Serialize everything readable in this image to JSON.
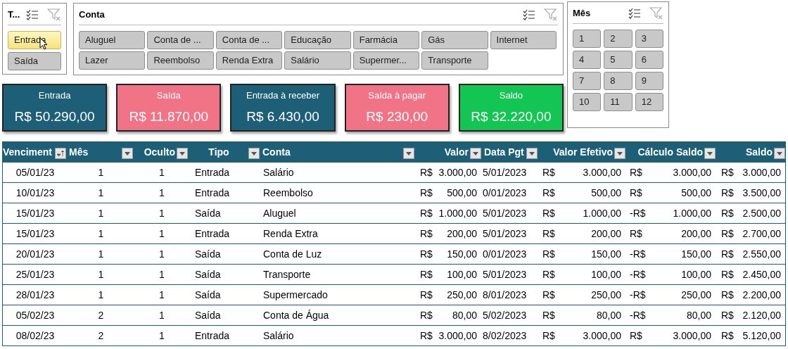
{
  "tipo_slicer": {
    "title": "T...",
    "items": [
      {
        "label": "Entrada",
        "selected": true
      },
      {
        "label": "Saída",
        "selected": false
      }
    ]
  },
  "conta_slicer": {
    "title": "Conta",
    "items": [
      {
        "label": "Aluguel",
        "selected": false
      },
      {
        "label": "Conta de ...",
        "selected": false
      },
      {
        "label": "Conta de ...",
        "selected": false
      },
      {
        "label": "Educação",
        "selected": false
      },
      {
        "label": "Farmácia",
        "selected": false
      },
      {
        "label": "Gás",
        "selected": false
      },
      {
        "label": "Internet",
        "selected": false
      },
      {
        "label": "Lazer",
        "selected": false
      },
      {
        "label": "Reembolso",
        "selected": false
      },
      {
        "label": "Renda Extra",
        "selected": false
      },
      {
        "label": "Salário",
        "selected": false
      },
      {
        "label": "Supermer...",
        "selected": false
      },
      {
        "label": "Transporte",
        "selected": false
      }
    ]
  },
  "mes_slicer": {
    "title": "Mês",
    "items": [
      {
        "label": "1",
        "selected": false
      },
      {
        "label": "2",
        "selected": false
      },
      {
        "label": "3",
        "selected": false
      },
      {
        "label": "4",
        "selected": false
      },
      {
        "label": "5",
        "selected": false
      },
      {
        "label": "6",
        "selected": false
      },
      {
        "label": "7",
        "selected": false
      },
      {
        "label": "8",
        "selected": false
      },
      {
        "label": "9",
        "selected": false
      },
      {
        "label": "10",
        "selected": false
      },
      {
        "label": "11",
        "selected": false
      },
      {
        "label": "12",
        "selected": false
      }
    ]
  },
  "cards": [
    {
      "label": "Entrada",
      "value": "R$ 50.290,00",
      "color": "#1e5f78"
    },
    {
      "label": "Saída",
      "value": "R$ 11.870,00",
      "color": "#f07386"
    },
    {
      "label": "Entrada à receber",
      "value": "R$ 6.430,00",
      "color": "#1e5f78"
    },
    {
      "label": "Saída à pagar",
      "value": "R$ 230,00",
      "color": "#f07386"
    },
    {
      "label": "Saldo",
      "value": "R$ 32.220,00",
      "color": "#13c552"
    }
  ],
  "table": {
    "columns": [
      {
        "label": "Venciment",
        "sorted": true
      },
      {
        "label": "Mês",
        "sorted": false
      },
      {
        "label": "Oculto",
        "sorted": false
      },
      {
        "label": "Tipo",
        "sorted": false
      },
      {
        "label": "Conta",
        "sorted": false
      },
      {
        "label": "Valor",
        "sorted": false
      },
      {
        "label": "Data Pgt",
        "sorted": false
      },
      {
        "label": "Valor Efetivo",
        "sorted": false
      },
      {
        "label": "Cálculo Saldo",
        "sorted": false
      },
      {
        "label": "Saldo",
        "sorted": false
      }
    ],
    "rows": [
      {
        "vencimento": "05/01/23",
        "mes": "1",
        "oculto": "1",
        "tipo": "Entrada",
        "conta": "Salário",
        "valor": [
          "R$",
          "3.000,00"
        ],
        "data_pgto": "5/01/2023",
        "valor_efetivo": [
          "R$",
          "3.000,00"
        ],
        "calculo_saldo": [
          "R$",
          "3.000,00"
        ],
        "saldo": [
          "R$",
          "3.000,00"
        ]
      },
      {
        "vencimento": "10/01/23",
        "mes": "1",
        "oculto": "1",
        "tipo": "Entrada",
        "conta": "Reembolso",
        "valor": [
          "R$",
          "500,00"
        ],
        "data_pgto": "0/01/2023",
        "valor_efetivo": [
          "R$",
          "500,00"
        ],
        "calculo_saldo": [
          "R$",
          "500,00"
        ],
        "saldo": [
          "R$",
          "3.500,00"
        ]
      },
      {
        "vencimento": "15/01/23",
        "mes": "1",
        "oculto": "1",
        "tipo": "Saída",
        "conta": "Aluguel",
        "valor": [
          "R$",
          "1.000,00"
        ],
        "data_pgto": "5/01/2023",
        "valor_efetivo": [
          "R$",
          "1.000,00"
        ],
        "calculo_saldo": [
          "-R$",
          "1.000,00"
        ],
        "saldo": [
          "R$",
          "2.500,00"
        ]
      },
      {
        "vencimento": "15/01/23",
        "mes": "1",
        "oculto": "1",
        "tipo": "Entrada",
        "conta": "Renda Extra",
        "valor": [
          "R$",
          "200,00"
        ],
        "data_pgto": "5/01/2023",
        "valor_efetivo": [
          "R$",
          "200,00"
        ],
        "calculo_saldo": [
          "R$",
          "200,00"
        ],
        "saldo": [
          "R$",
          "2.700,00"
        ]
      },
      {
        "vencimento": "20/01/23",
        "mes": "1",
        "oculto": "1",
        "tipo": "Saída",
        "conta": "Conta de Luz",
        "valor": [
          "R$",
          "150,00"
        ],
        "data_pgto": "0/01/2023",
        "valor_efetivo": [
          "R$",
          "150,00"
        ],
        "calculo_saldo": [
          "-R$",
          "150,00"
        ],
        "saldo": [
          "R$",
          "2.550,00"
        ]
      },
      {
        "vencimento": "25/01/23",
        "mes": "1",
        "oculto": "1",
        "tipo": "Saída",
        "conta": "Transporte",
        "valor": [
          "R$",
          "100,00"
        ],
        "data_pgto": "5/01/2023",
        "valor_efetivo": [
          "R$",
          "100,00"
        ],
        "calculo_saldo": [
          "-R$",
          "100,00"
        ],
        "saldo": [
          "R$",
          "2.450,00"
        ]
      },
      {
        "vencimento": "28/01/23",
        "mes": "1",
        "oculto": "1",
        "tipo": "Saída",
        "conta": "Supermercado",
        "valor": [
          "R$",
          "250,00"
        ],
        "data_pgto": "8/01/2023",
        "valor_efetivo": [
          "R$",
          "250,00"
        ],
        "calculo_saldo": [
          "-R$",
          "250,00"
        ],
        "saldo": [
          "R$",
          "2.200,00"
        ]
      },
      {
        "vencimento": "05/02/23",
        "mes": "2",
        "oculto": "1",
        "tipo": "Saída",
        "conta": "Conta de Água",
        "valor": [
          "R$",
          "80,00"
        ],
        "data_pgto": "5/02/2023",
        "valor_efetivo": [
          "R$",
          "80,00"
        ],
        "calculo_saldo": [
          "-R$",
          "80,00"
        ],
        "saldo": [
          "R$",
          "2.120,00"
        ]
      },
      {
        "vencimento": "08/02/23",
        "mes": "2",
        "oculto": "1",
        "tipo": "Entrada",
        "conta": "Salário",
        "valor": [
          "R$",
          "3.000,00"
        ],
        "data_pgto": "8/02/2023",
        "valor_efetivo": [
          "R$",
          "3.000,00"
        ],
        "calculo_saldo": [
          "R$",
          "3.000,00"
        ],
        "saldo": [
          "R$",
          "5.120,00"
        ]
      }
    ]
  }
}
